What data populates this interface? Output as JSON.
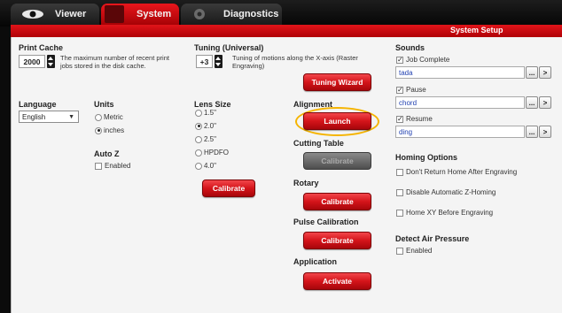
{
  "tabs": [
    {
      "label": "Viewer"
    },
    {
      "label": "System"
    },
    {
      "label": "Diagnostics"
    }
  ],
  "header": {
    "title": "System Setup"
  },
  "print_cache": {
    "title": "Print Cache",
    "value": "2000",
    "description": "The maximum number of recent print jobs stored in the disk cache."
  },
  "tuning": {
    "title": "Tuning (Universal)",
    "value": "+3",
    "description": "Tuning of motions along the X-axis (Raster Engraving)",
    "button": "Tuning Wizard"
  },
  "language": {
    "title": "Language",
    "selected": "English"
  },
  "units": {
    "title": "Units",
    "options": [
      "Metric",
      "inches"
    ],
    "selected": "inches"
  },
  "autoz": {
    "title": "Auto Z",
    "enabled_label": "Enabled"
  },
  "lens": {
    "title": "Lens Size",
    "options": [
      "1.5\"",
      "2.0\"",
      "2.5\"",
      "HPDFO",
      "4.0\""
    ],
    "selected": "2.0\"",
    "button": "Calibrate"
  },
  "alignment": {
    "title": "Alignment",
    "button": "Launch"
  },
  "cutting_table": {
    "title": "Cutting Table",
    "button": "Calibrate"
  },
  "rotary": {
    "title": "Rotary",
    "button": "Calibrate"
  },
  "pulse": {
    "title": "Pulse Calibration",
    "button": "Calibrate"
  },
  "application": {
    "title": "Application",
    "button": "Activate"
  },
  "sounds": {
    "title": "Sounds",
    "items": [
      {
        "label": "Job Complete",
        "checked": true,
        "value": "tada"
      },
      {
        "label": "Pause",
        "checked": true,
        "value": "chord"
      },
      {
        "label": "Resume",
        "checked": true,
        "value": "ding"
      }
    ],
    "browse_label": "...",
    "play_icon": "play-icon"
  },
  "homing": {
    "title": "Homing Options",
    "options": [
      "Don't Return Home After Engraving",
      "Disable Automatic Z-Homing",
      "Home XY Before Engraving"
    ]
  },
  "air": {
    "title": "Detect Air Pressure",
    "enabled_label": "Enabled"
  },
  "colors": {
    "accent": "#d4141a",
    "highlight": "#f5b400",
    "panel": "#f4f4f4"
  }
}
